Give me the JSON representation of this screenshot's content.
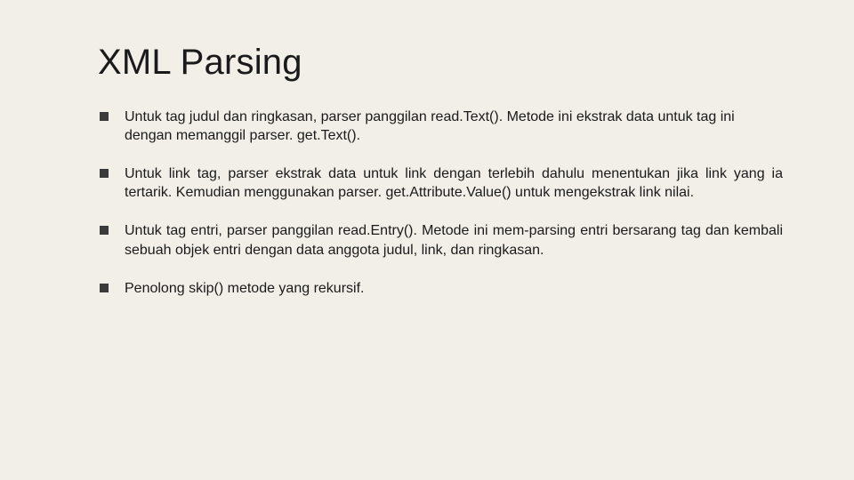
{
  "slide": {
    "title": "XML Parsing",
    "bullets": [
      "Untuk tag judul dan ringkasan, parser panggilan read.Text(). Metode ini ekstrak data untuk tag ini dengan memanggil parser. get.Text().",
      "Untuk link tag, parser ekstrak data untuk link dengan terlebih dahulu menentukan jika link yang ia tertarik. Kemudian menggunakan parser. get.Attribute.Value() untuk mengekstrak link nilai.",
      "Untuk tag entri, parser panggilan read.Entry(). Metode ini mem-parsing entri bersarang tag dan kembali sebuah objek entri dengan data anggota judul, link, dan ringkasan.",
      "Penolong skip() metode yang rekursif."
    ]
  }
}
